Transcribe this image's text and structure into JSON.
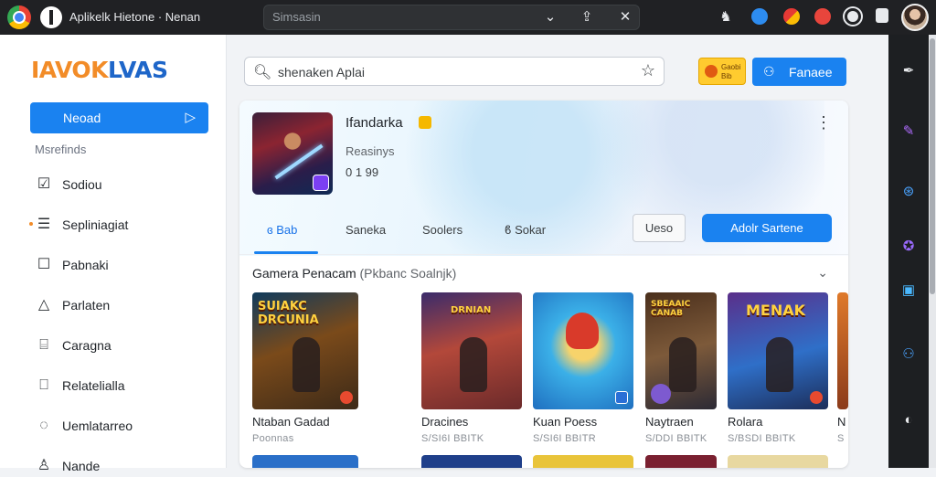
{
  "window": {
    "title": "Aplikelk Ніetone · Nenan",
    "address_text": "Simsasin"
  },
  "sidebar": {
    "brand_part1": "IAVOK",
    "brand_part2": "LVAS",
    "active_item": "Neoad",
    "section_label": "Msrefinds",
    "items": [
      {
        "label": "Sodiou",
        "icon": "checkbox-icon"
      },
      {
        "label": "Sepliniagiat",
        "icon": "list-icon"
      },
      {
        "label": "Pabnaki",
        "icon": "square-icon"
      },
      {
        "label": "Parlaten",
        "icon": "bell-icon"
      },
      {
        "label": "Caragna",
        "icon": "camera-icon"
      },
      {
        "label": "Relatelialla",
        "icon": "book-icon"
      },
      {
        "label": "Uemlatarreo",
        "icon": "chat-icon"
      },
      {
        "label": "Nande",
        "icon": "user-icon"
      }
    ]
  },
  "header": {
    "search_text": "shenaken  Aplai",
    "promo_text": "Gaobi\nBib",
    "sign_label": "Fanaee"
  },
  "app": {
    "name": "Ifandarka",
    "subtitle": "Reasinys",
    "meta": "0 1 99",
    "tabs": [
      {
        "label": "ɞ Bab",
        "active": true
      },
      {
        "label": "Saneka",
        "active": false
      },
      {
        "label": "Soolers",
        "active": false
      },
      {
        "label": "ϐ Sokar",
        "active": false
      }
    ],
    "secondary_btn": "Ueso",
    "primary_btn": "Adolr Sartene"
  },
  "games": {
    "section_title": "Gamera Penacam",
    "section_hint": "(Pkbanc Soalnjk)",
    "tiles": [
      {
        "art_title": "SUIAKC\nDRCUNIA",
        "name": "Ntaban Gadad",
        "sub": "Poonnas"
      },
      {
        "art_title": "DRNIAN",
        "name": "Dracines",
        "sub": "S/SI6I BBITK"
      },
      {
        "art_title": "",
        "name": "Kuan Poess",
        "sub": "S/SI6I BBITR"
      },
      {
        "art_title": "SBEAAIC\nCANAB",
        "name": "Naytraen",
        "sub": "S/DDI BBITK"
      },
      {
        "art_title": "MENAK",
        "name": "Rolara",
        "sub": "S/BSDI BBITK"
      },
      {
        "art_title": "",
        "name": "N",
        "sub": "S"
      }
    ]
  },
  "colors": {
    "accent": "#1a82f0",
    "brand_orange": "#f28c28",
    "brand_blue": "#1e66c9",
    "topbar": "#202124"
  }
}
